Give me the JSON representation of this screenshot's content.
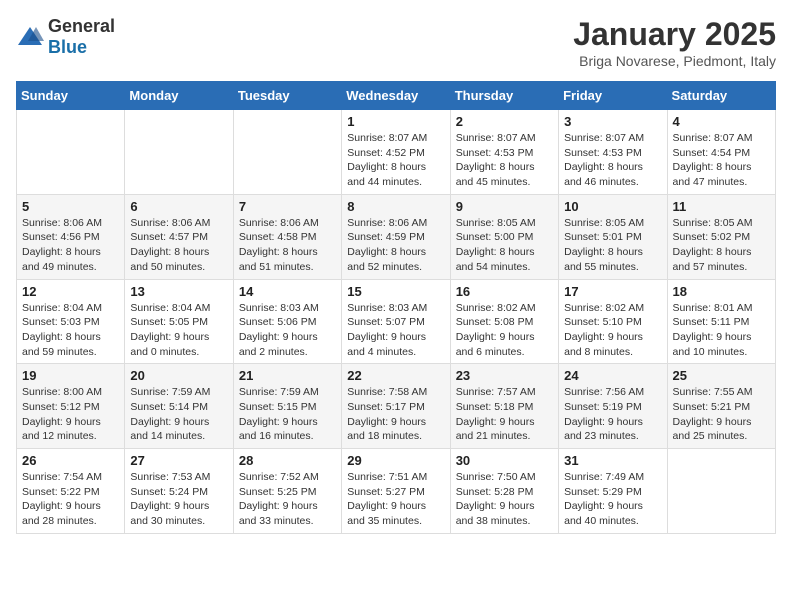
{
  "header": {
    "logo_general": "General",
    "logo_blue": "Blue",
    "month_title": "January 2025",
    "subtitle": "Briga Novarese, Piedmont, Italy"
  },
  "days_of_week": [
    "Sunday",
    "Monday",
    "Tuesday",
    "Wednesday",
    "Thursday",
    "Friday",
    "Saturday"
  ],
  "weeks": [
    [
      {
        "day": "",
        "info": ""
      },
      {
        "day": "",
        "info": ""
      },
      {
        "day": "",
        "info": ""
      },
      {
        "day": "1",
        "info": "Sunrise: 8:07 AM\nSunset: 4:52 PM\nDaylight: 8 hours\nand 44 minutes."
      },
      {
        "day": "2",
        "info": "Sunrise: 8:07 AM\nSunset: 4:53 PM\nDaylight: 8 hours\nand 45 minutes."
      },
      {
        "day": "3",
        "info": "Sunrise: 8:07 AM\nSunset: 4:53 PM\nDaylight: 8 hours\nand 46 minutes."
      },
      {
        "day": "4",
        "info": "Sunrise: 8:07 AM\nSunset: 4:54 PM\nDaylight: 8 hours\nand 47 minutes."
      }
    ],
    [
      {
        "day": "5",
        "info": "Sunrise: 8:06 AM\nSunset: 4:56 PM\nDaylight: 8 hours\nand 49 minutes."
      },
      {
        "day": "6",
        "info": "Sunrise: 8:06 AM\nSunset: 4:57 PM\nDaylight: 8 hours\nand 50 minutes."
      },
      {
        "day": "7",
        "info": "Sunrise: 8:06 AM\nSunset: 4:58 PM\nDaylight: 8 hours\nand 51 minutes."
      },
      {
        "day": "8",
        "info": "Sunrise: 8:06 AM\nSunset: 4:59 PM\nDaylight: 8 hours\nand 52 minutes."
      },
      {
        "day": "9",
        "info": "Sunrise: 8:05 AM\nSunset: 5:00 PM\nDaylight: 8 hours\nand 54 minutes."
      },
      {
        "day": "10",
        "info": "Sunrise: 8:05 AM\nSunset: 5:01 PM\nDaylight: 8 hours\nand 55 minutes."
      },
      {
        "day": "11",
        "info": "Sunrise: 8:05 AM\nSunset: 5:02 PM\nDaylight: 8 hours\nand 57 minutes."
      }
    ],
    [
      {
        "day": "12",
        "info": "Sunrise: 8:04 AM\nSunset: 5:03 PM\nDaylight: 8 hours\nand 59 minutes."
      },
      {
        "day": "13",
        "info": "Sunrise: 8:04 AM\nSunset: 5:05 PM\nDaylight: 9 hours\nand 0 minutes."
      },
      {
        "day": "14",
        "info": "Sunrise: 8:03 AM\nSunset: 5:06 PM\nDaylight: 9 hours\nand 2 minutes."
      },
      {
        "day": "15",
        "info": "Sunrise: 8:03 AM\nSunset: 5:07 PM\nDaylight: 9 hours\nand 4 minutes."
      },
      {
        "day": "16",
        "info": "Sunrise: 8:02 AM\nSunset: 5:08 PM\nDaylight: 9 hours\nand 6 minutes."
      },
      {
        "day": "17",
        "info": "Sunrise: 8:02 AM\nSunset: 5:10 PM\nDaylight: 9 hours\nand 8 minutes."
      },
      {
        "day": "18",
        "info": "Sunrise: 8:01 AM\nSunset: 5:11 PM\nDaylight: 9 hours\nand 10 minutes."
      }
    ],
    [
      {
        "day": "19",
        "info": "Sunrise: 8:00 AM\nSunset: 5:12 PM\nDaylight: 9 hours\nand 12 minutes."
      },
      {
        "day": "20",
        "info": "Sunrise: 7:59 AM\nSunset: 5:14 PM\nDaylight: 9 hours\nand 14 minutes."
      },
      {
        "day": "21",
        "info": "Sunrise: 7:59 AM\nSunset: 5:15 PM\nDaylight: 9 hours\nand 16 minutes."
      },
      {
        "day": "22",
        "info": "Sunrise: 7:58 AM\nSunset: 5:17 PM\nDaylight: 9 hours\nand 18 minutes."
      },
      {
        "day": "23",
        "info": "Sunrise: 7:57 AM\nSunset: 5:18 PM\nDaylight: 9 hours\nand 21 minutes."
      },
      {
        "day": "24",
        "info": "Sunrise: 7:56 AM\nSunset: 5:19 PM\nDaylight: 9 hours\nand 23 minutes."
      },
      {
        "day": "25",
        "info": "Sunrise: 7:55 AM\nSunset: 5:21 PM\nDaylight: 9 hours\nand 25 minutes."
      }
    ],
    [
      {
        "day": "26",
        "info": "Sunrise: 7:54 AM\nSunset: 5:22 PM\nDaylight: 9 hours\nand 28 minutes."
      },
      {
        "day": "27",
        "info": "Sunrise: 7:53 AM\nSunset: 5:24 PM\nDaylight: 9 hours\nand 30 minutes."
      },
      {
        "day": "28",
        "info": "Sunrise: 7:52 AM\nSunset: 5:25 PM\nDaylight: 9 hours\nand 33 minutes."
      },
      {
        "day": "29",
        "info": "Sunrise: 7:51 AM\nSunset: 5:27 PM\nDaylight: 9 hours\nand 35 minutes."
      },
      {
        "day": "30",
        "info": "Sunrise: 7:50 AM\nSunset: 5:28 PM\nDaylight: 9 hours\nand 38 minutes."
      },
      {
        "day": "31",
        "info": "Sunrise: 7:49 AM\nSunset: 5:29 PM\nDaylight: 9 hours\nand 40 minutes."
      },
      {
        "day": "",
        "info": ""
      }
    ]
  ]
}
